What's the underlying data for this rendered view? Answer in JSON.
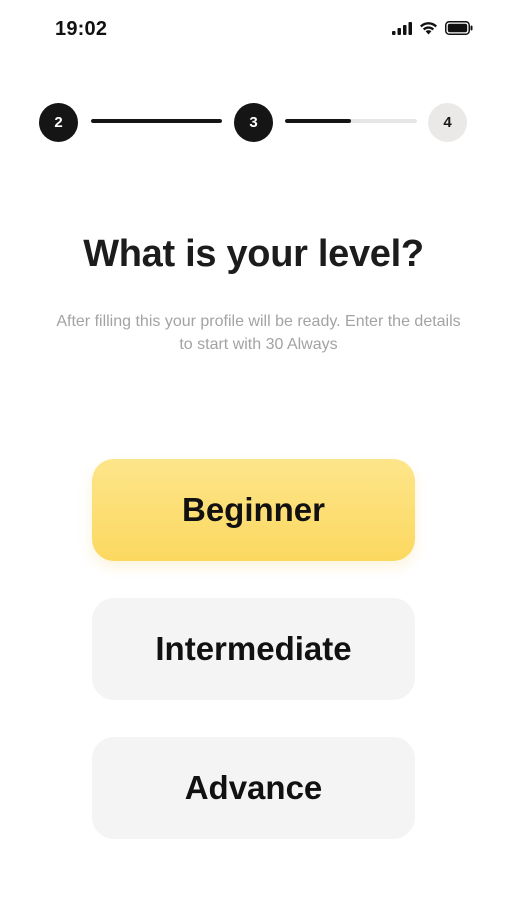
{
  "status_bar": {
    "time": "19:02",
    "icons": [
      "cellular-signal-icon",
      "wifi-icon",
      "battery-icon"
    ]
  },
  "stepper": {
    "steps": [
      {
        "label": "2",
        "state": "done"
      },
      {
        "label": "3",
        "state": "done"
      },
      {
        "label": "4",
        "state": "pending"
      }
    ],
    "connectors": [
      {
        "progress": 1.0
      },
      {
        "progress": 0.5
      }
    ]
  },
  "header": {
    "title": "What is your level?",
    "subtitle": "After filling this your profile will be ready. Enter the details to start with 30 Always"
  },
  "levels": {
    "selected_index": 0,
    "options": [
      {
        "label": "Beginner"
      },
      {
        "label": "Intermediate"
      },
      {
        "label": "Advance"
      }
    ]
  },
  "colors": {
    "selected_option": "#fcd860",
    "unselected_option": "#f5f4f4",
    "step_done": "#151515",
    "step_pending": "#ebe9e8",
    "subtitle_text": "#a3a3a3"
  }
}
